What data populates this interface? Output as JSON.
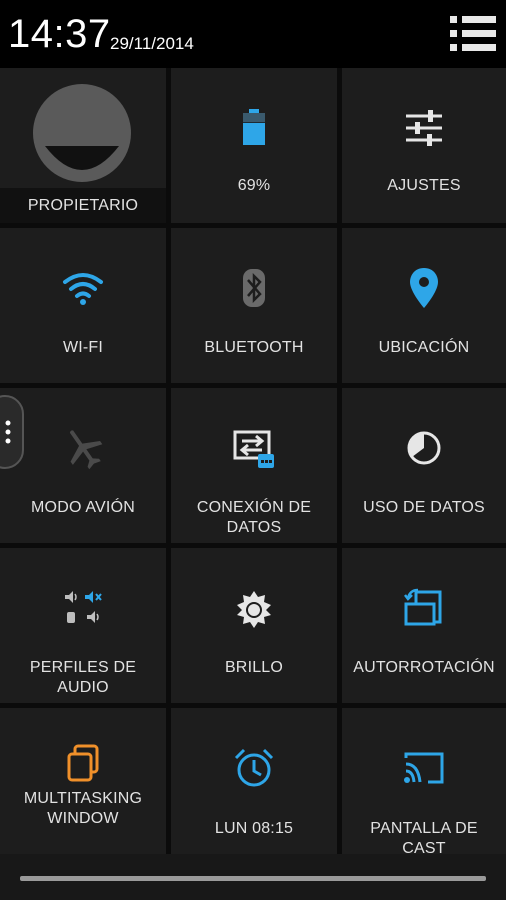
{
  "status": {
    "time": "14:37",
    "date": "29/11/2014"
  },
  "tiles": {
    "owner": "PROPIETARIO",
    "battery": "69%",
    "settings": "AJUSTES",
    "wifi": "WI-FI",
    "bluetooth": "BLUETOOTH",
    "location": "UBICACIÓN",
    "airplane": "MODO AVIÓN",
    "data_conn_1": "CONEXIÓN DE",
    "data_conn_2": "DATOS",
    "data_usage": "USO DE DATOS",
    "audio_1": "PERFILES DE",
    "audio_2": "AUDIO",
    "brightness": "BRILLO",
    "autorotate": "AUTORROTACIÓN",
    "multitask_1": "MULTITASKING",
    "multitask_2": "WINDOW",
    "alarm": "LUN 08:15",
    "cast_1": "PANTALLA DE",
    "cast_2": "CAST"
  },
  "battery_level": 0.69,
  "colors": {
    "accent": "#2ea6e8",
    "orange": "#f0902a",
    "tile": "#1d1d1d"
  }
}
